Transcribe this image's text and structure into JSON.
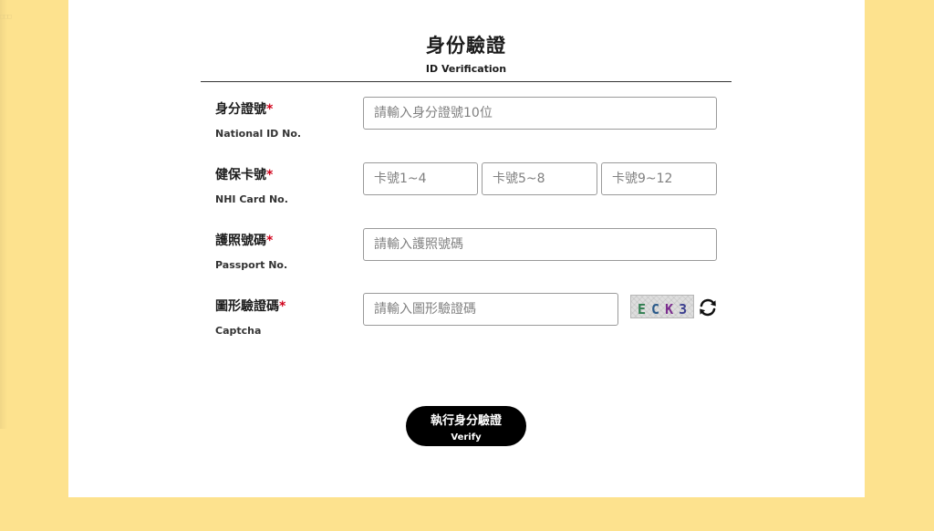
{
  "page": {
    "title_zh": "身份驗證",
    "title_en": "ID Verification",
    "edge_text": "□□□"
  },
  "form": {
    "national_id": {
      "label_zh": "身分證號",
      "required_mark": "*",
      "label_en": "National ID No.",
      "placeholder": "請輸入身分證號10位"
    },
    "nhi_card": {
      "label_zh": "健保卡號",
      "required_mark": "*",
      "label_en": "NHI Card No.",
      "placeholders": [
        "卡號1~4",
        "卡號5~8",
        "卡號9~12"
      ]
    },
    "passport": {
      "label_zh": "護照號碼",
      "required_mark": "*",
      "label_en": "Passport No.",
      "placeholder": "請輸入護照號碼"
    },
    "captcha": {
      "label_zh": "圖形驗證碼",
      "required_mark": "*",
      "label_en": "Captcha",
      "placeholder": "請輸入圖形驗證碼",
      "image_chars": [
        "E",
        "C",
        "K",
        "3"
      ],
      "image_colors": [
        "#2f7d4f",
        "#2a5a8a",
        "#7b2d8e",
        "#3b3f8f"
      ],
      "refresh_icon": "refresh-icon"
    }
  },
  "actions": {
    "verify_zh": "執行身分驗證",
    "verify_en": "Verify"
  },
  "colors": {
    "background": "#fde28e",
    "panel": "#ffffff",
    "required": "#d0021b",
    "button": "#000000"
  }
}
